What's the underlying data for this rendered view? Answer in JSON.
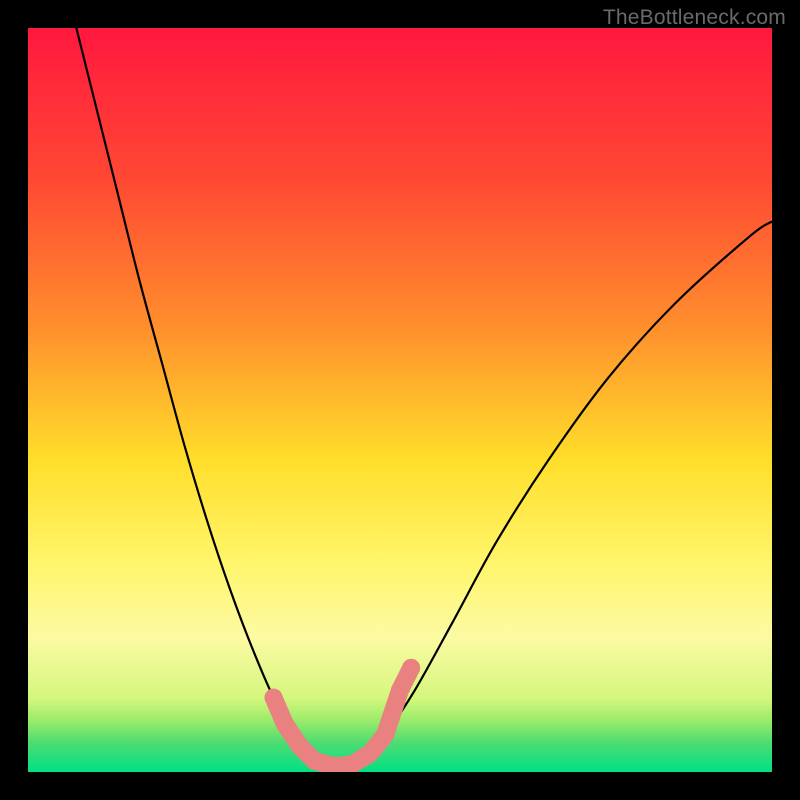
{
  "watermark": "TheBottleneck.com",
  "chart_data": {
    "type": "line",
    "title": "",
    "xlabel": "",
    "ylabel": "",
    "xlim": [
      0,
      100
    ],
    "ylim": [
      0,
      100
    ],
    "background_gradient": {
      "stops": [
        {
          "offset": 0,
          "color": "#ff183f"
        },
        {
          "offset": 20,
          "color": "#ff4733"
        },
        {
          "offset": 40,
          "color": "#ff8e2d"
        },
        {
          "offset": 58,
          "color": "#ffde2a"
        },
        {
          "offset": 72,
          "color": "#fff66c"
        },
        {
          "offset": 82,
          "color": "#fcfaa3"
        },
        {
          "offset": 90,
          "color": "#d5f77e"
        },
        {
          "offset": 93,
          "color": "#9cec6a"
        },
        {
          "offset": 96,
          "color": "#4fdc72"
        },
        {
          "offset": 100,
          "color": "#00e184"
        }
      ]
    },
    "series": [
      {
        "name": "bottleneck-curve",
        "stroke": "#000000",
        "points": [
          {
            "x": 6.5,
            "y": 100.0
          },
          {
            "x": 9.0,
            "y": 90.0
          },
          {
            "x": 12.0,
            "y": 78.0
          },
          {
            "x": 15.0,
            "y": 66.0
          },
          {
            "x": 18.0,
            "y": 55.0
          },
          {
            "x": 21.0,
            "y": 44.0
          },
          {
            "x": 24.0,
            "y": 34.0
          },
          {
            "x": 27.0,
            "y": 25.0
          },
          {
            "x": 30.0,
            "y": 17.0
          },
          {
            "x": 33.0,
            "y": 10.0
          },
          {
            "x": 36.0,
            "y": 4.5
          },
          {
            "x": 39.0,
            "y": 1.5
          },
          {
            "x": 42.0,
            "y": 0.5
          },
          {
            "x": 45.0,
            "y": 1.5
          },
          {
            "x": 48.0,
            "y": 5.0
          },
          {
            "x": 52.0,
            "y": 11.0
          },
          {
            "x": 57.0,
            "y": 20.0
          },
          {
            "x": 63.0,
            "y": 31.0
          },
          {
            "x": 70.0,
            "y": 42.0
          },
          {
            "x": 78.0,
            "y": 53.0
          },
          {
            "x": 87.0,
            "y": 63.0
          },
          {
            "x": 97.0,
            "y": 72.0
          },
          {
            "x": 100.0,
            "y": 74.0
          }
        ]
      },
      {
        "name": "highlight-markers",
        "stroke": "#e98181",
        "marker_radius": 9,
        "points": [
          {
            "x": 33.0,
            "y": 10.0
          },
          {
            "x": 34.5,
            "y": 6.5
          },
          {
            "x": 36.5,
            "y": 3.5
          },
          {
            "x": 38.5,
            "y": 1.5
          },
          {
            "x": 41.0,
            "y": 0.8
          },
          {
            "x": 43.5,
            "y": 1.0
          },
          {
            "x": 46.0,
            "y": 2.5
          },
          {
            "x": 48.0,
            "y": 5.0
          },
          {
            "x": 50.0,
            "y": 11.0
          },
          {
            "x": 51.5,
            "y": 14.0
          }
        ]
      }
    ]
  }
}
